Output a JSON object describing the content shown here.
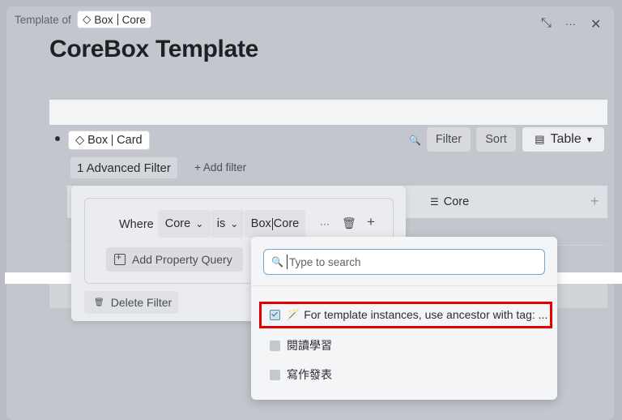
{
  "header": {
    "template_of_label": "Template of",
    "template_tag": {
      "left": "Box",
      "right": "Core"
    },
    "title": "CoreBox Template"
  },
  "window_controls": {
    "expand_icon": "⤡",
    "more_icon": "···",
    "close_icon": "✕"
  },
  "block": {
    "tag": {
      "left": "Box",
      "right": "Card"
    }
  },
  "toolbar": {
    "search_icon": "🔍",
    "filter_label": "Filter",
    "sort_label": "Sort",
    "view_label": "Table",
    "view_caret": "▾"
  },
  "filters": {
    "advanced_filter_label": "1 Advanced Filter",
    "add_filter_label": "+ Add filter"
  },
  "table": {
    "column_icon": "☰",
    "column_label": "Core",
    "add_column_icon": "+"
  },
  "filter_panel": {
    "where_label": "Where",
    "property_label": "Core",
    "property_caret": "⌄",
    "operator_label": "is",
    "operator_caret": "⌄",
    "value": {
      "left": "Box",
      "right": "Core"
    },
    "more_icon": "···",
    "trash_icon": "🗑",
    "add_icon": "+",
    "add_property_query_label": "Add Property Query",
    "delete_filter_icon": "🗑",
    "delete_filter_label": "Delete Filter"
  },
  "dropdown": {
    "search_icon": "🔍",
    "search_placeholder": "Type to search",
    "search_value": "",
    "options": [
      {
        "label": "For template instances, use ancestor with tag: ...",
        "checked": true,
        "icon": "🪄"
      },
      {
        "label": "閱讀學習",
        "checked": false
      },
      {
        "label": "寫作發表",
        "checked": false
      }
    ]
  },
  "colors": {
    "highlight": "#e00000",
    "focus": "#6fa6d6"
  }
}
